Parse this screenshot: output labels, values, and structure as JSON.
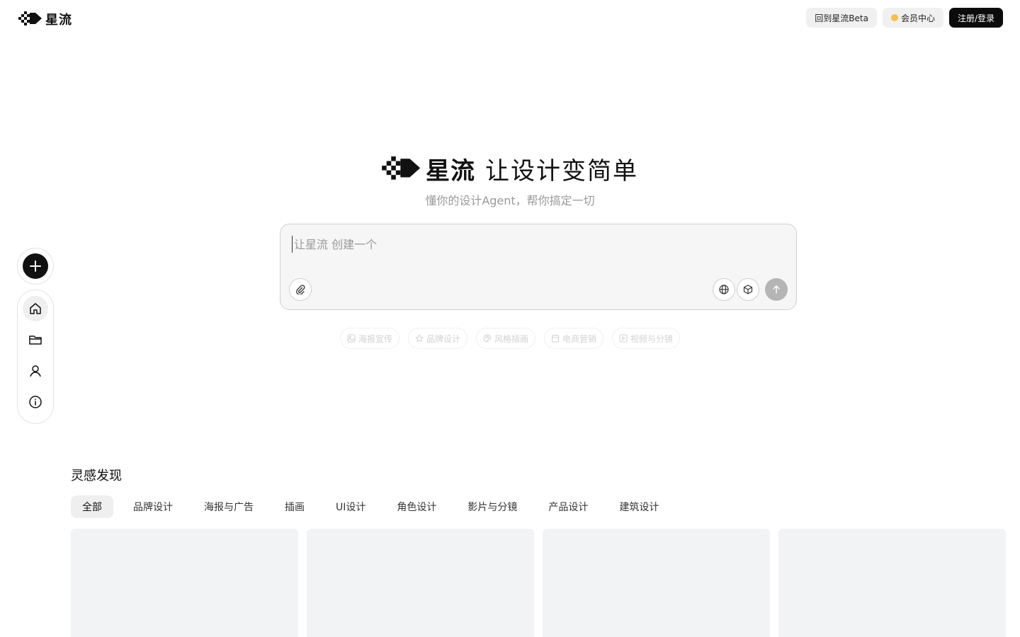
{
  "brand": {
    "name": "星流",
    "slogan": "让设计变简单",
    "subtitle": "懂你的设计Agent，帮你搞定一切"
  },
  "header": {
    "back_beta": "回到星流Beta",
    "member_center": "会员中心",
    "login": "注册/登录"
  },
  "rail": {
    "icons": [
      "plus-icon",
      "home-icon",
      "folder-icon",
      "user-icon",
      "info-icon"
    ]
  },
  "prompt": {
    "placeholder": "让星流 创建一个",
    "value": ""
  },
  "chips": [
    {
      "label": "海报宣传",
      "icon": "image-icon"
    },
    {
      "label": "品牌设计",
      "icon": "star-icon"
    },
    {
      "label": "风格插画",
      "icon": "palette-icon"
    },
    {
      "label": "电商营销",
      "icon": "shop-icon"
    },
    {
      "label": "视频与分镜",
      "icon": "video-icon"
    }
  ],
  "discover": {
    "title": "灵感发现",
    "tabs": [
      "全部",
      "品牌设计",
      "海报与广告",
      "插画",
      "UI设计",
      "角色设计",
      "影片与分镜",
      "产品设计",
      "建筑设计"
    ],
    "active_tab": "全部"
  },
  "colors": {
    "primary_dark": "#0b0b0b",
    "card_bg": "#f2f3f5",
    "vip_dot": "#f5c04a"
  }
}
